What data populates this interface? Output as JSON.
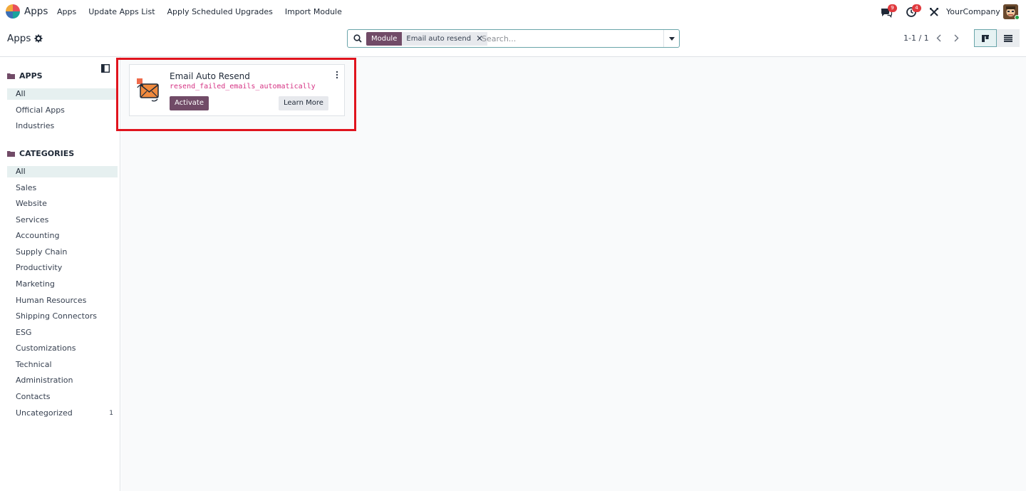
{
  "navbar": {
    "app_name": "Apps",
    "menu": [
      "Apps",
      "Update Apps List",
      "Apply Scheduled Upgrades",
      "Import Module"
    ],
    "messages_badge": "9",
    "activities_badge": "4",
    "company": "YourCompany"
  },
  "control": {
    "breadcrumb": "Apps",
    "facet_label": "Module",
    "facet_value": "Email auto resend",
    "search_placeholder": "Search...",
    "pager": "1-1 / 1"
  },
  "sidebar": {
    "apps_heading": "APPS",
    "apps_items": [
      "All",
      "Official Apps",
      "Industries"
    ],
    "categories_heading": "CATEGORIES",
    "category_items": [
      "All",
      "Sales",
      "Website",
      "Services",
      "Accounting",
      "Supply Chain",
      "Productivity",
      "Marketing",
      "Human Resources",
      "Shipping Connectors",
      "ESG",
      "Customizations",
      "Technical",
      "Administration",
      "Contacts",
      "Uncategorized"
    ],
    "uncategorized_count": "1"
  },
  "card": {
    "title": "Email Auto Resend",
    "technical_name": "resend_failed_emails_automatically",
    "activate_label": "Activate",
    "learn_more_label": "Learn More"
  },
  "colors": {
    "brand": "#714b67",
    "highlight": "#e0141e",
    "badge": "#e03a3e"
  }
}
